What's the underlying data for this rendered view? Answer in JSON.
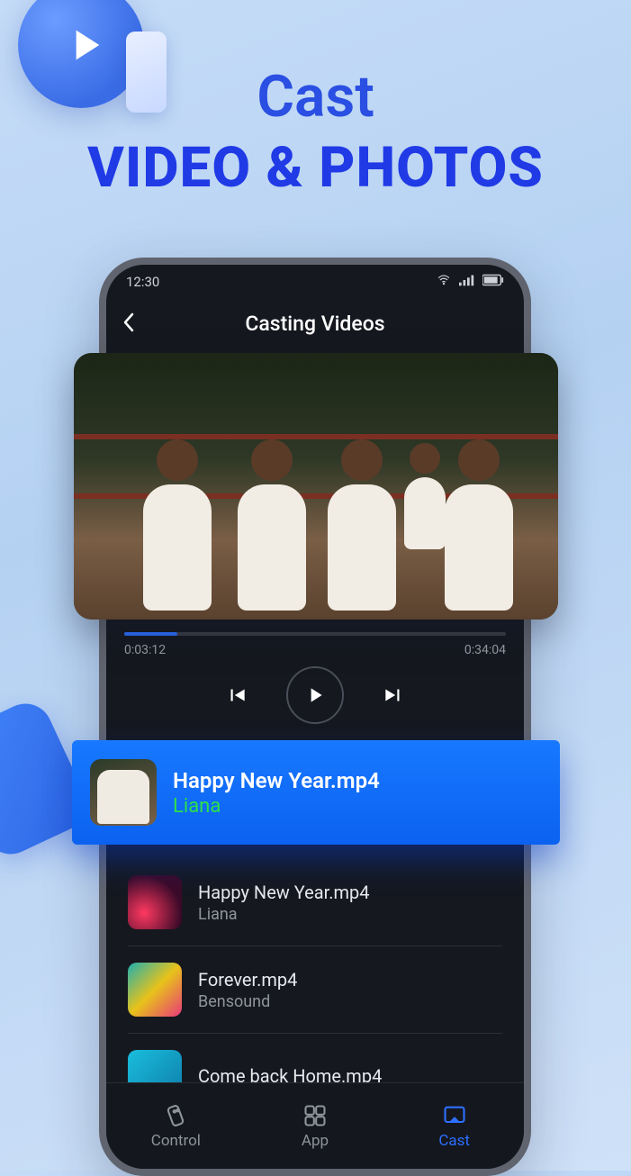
{
  "headline": {
    "line1": "Cast",
    "line2": "VIDEO & PHOTOS"
  },
  "status": {
    "time": "12:30"
  },
  "header": {
    "title": "Casting Videos"
  },
  "player": {
    "elapsed": "0:03:12",
    "duration": "0:34:04"
  },
  "now_playing": {
    "title": "Happy New Year.mp4",
    "artist": "Liana"
  },
  "list": [
    {
      "title": "Happy New Year.mp4",
      "subtitle": "Liana"
    },
    {
      "title": "Forever.mp4",
      "subtitle": "Bensound"
    },
    {
      "title": "Come back Home.mp4",
      "subtitle": ""
    }
  ],
  "nav": {
    "control": "Control",
    "app": "App",
    "cast": "Cast"
  }
}
